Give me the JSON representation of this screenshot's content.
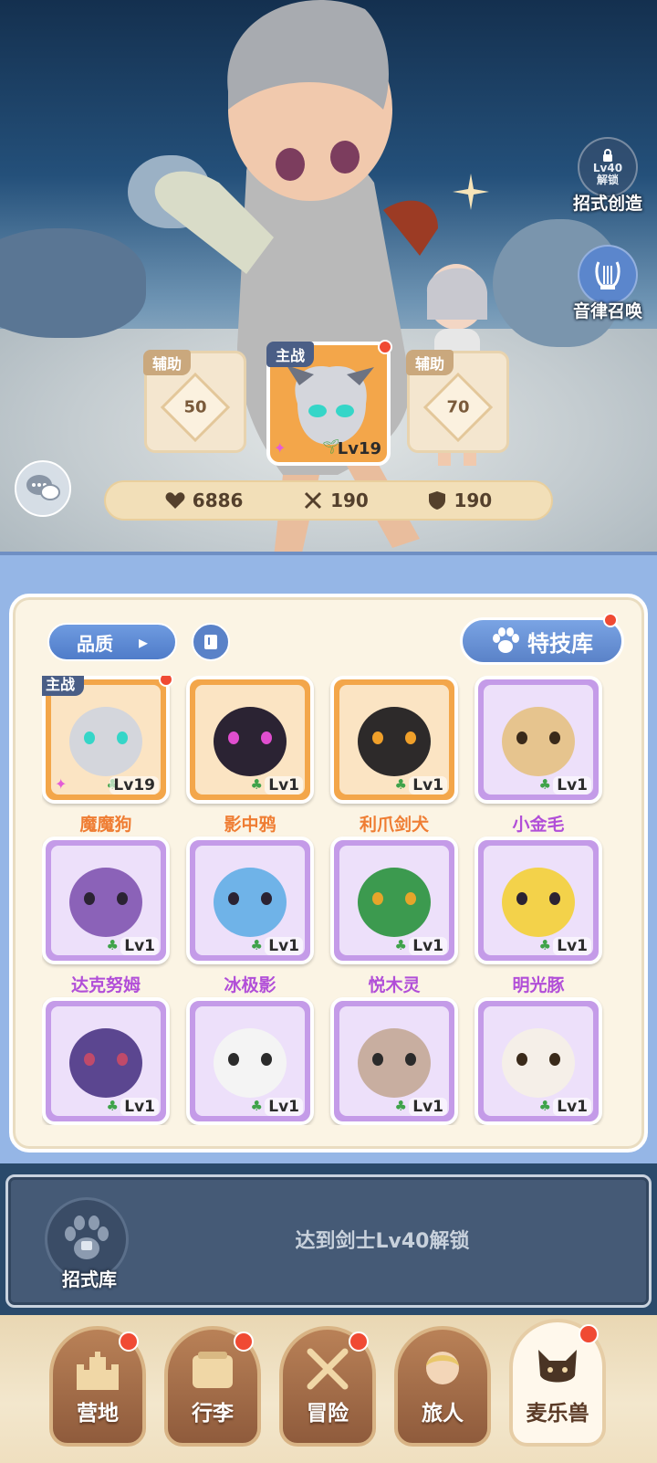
{
  "side_buttons": {
    "create": {
      "lock_level": "Lv40",
      "lock_text": "解锁",
      "label": "招式创造"
    },
    "summon": {
      "label": "音律召唤"
    }
  },
  "team": {
    "assist_left": {
      "tag": "辅助",
      "value": "50"
    },
    "main": {
      "tag": "主战",
      "level": "Lv19"
    },
    "assist_right": {
      "tag": "辅助",
      "value": "70"
    }
  },
  "stats": {
    "hp": "6886",
    "attack": "190",
    "defense": "190"
  },
  "toolbar": {
    "quality_label": "品质",
    "skill_library_label": "特技库"
  },
  "pets": [
    {
      "name": "魔魔狗",
      "level": "Lv19",
      "rarity": "orange",
      "main": true
    },
    {
      "name": "影中鸦",
      "level": "Lv1",
      "rarity": "orange"
    },
    {
      "name": "利爪剑犬",
      "level": "Lv1",
      "rarity": "orange"
    },
    {
      "name": "小金毛",
      "level": "Lv1",
      "rarity": "purple"
    },
    {
      "name": "达克努姆",
      "level": "Lv1",
      "rarity": "purple"
    },
    {
      "name": "冰极影",
      "level": "Lv1",
      "rarity": "purple"
    },
    {
      "name": "悦木灵",
      "level": "Lv1",
      "rarity": "purple"
    },
    {
      "name": "明光豚",
      "level": "Lv1",
      "rarity": "purple"
    },
    {
      "name": "",
      "level": "Lv1",
      "rarity": "purple"
    },
    {
      "name": "",
      "level": "Lv1",
      "rarity": "purple"
    },
    {
      "name": "",
      "level": "Lv1",
      "rarity": "purple"
    },
    {
      "name": "",
      "level": "Lv1",
      "rarity": "purple"
    }
  ],
  "main_tag": "主战",
  "locked": {
    "label": "招式库",
    "message": "达到剑士Lv40解锁"
  },
  "nav": [
    {
      "label": "营地"
    },
    {
      "label": "行李"
    },
    {
      "label": "冒险"
    },
    {
      "label": "旅人"
    },
    {
      "label": "麦乐兽"
    }
  ],
  "colors": {
    "orange_name": "#ef7d33",
    "purple_name": "#b14ed8",
    "notify": "#f04a33"
  }
}
